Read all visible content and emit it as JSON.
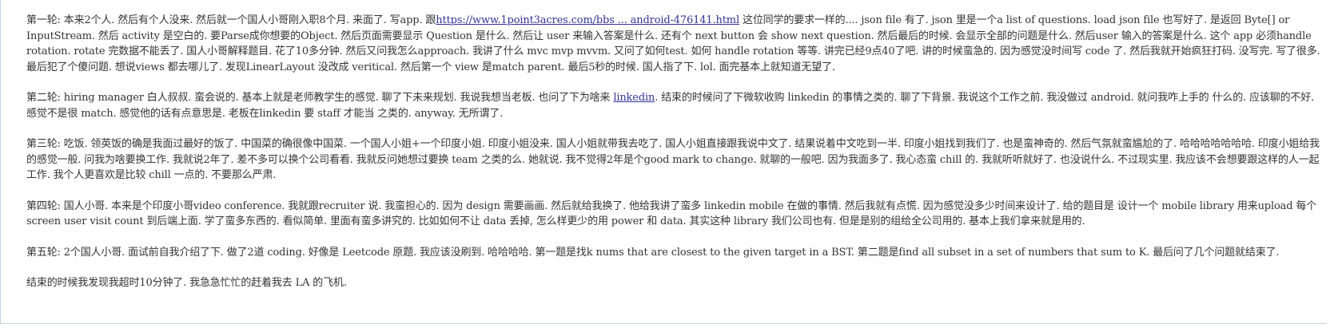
{
  "post": {
    "round1": {
      "before_link": "第一轮: 本来2个人. 然后有个人没来. 然后就一个国人小哥刚入职8个月. 来面了. 写app. 跟",
      "link_text": "https://www.1point3acres.com/bbs ... android-476141.html",
      "after_link": " 这位同学的要求一样的.... json file 有了. json 里是一个a list of questions. load json file 也写好了. 是返回 Byte[] or InputStream. 然后 activity 是空白的. 要Parse成你想要的Object. 然后页面需要显示 Question 是什么. 然后让 user 来输入答案是什么. 还有个 next button 会 show next question. 然后最后的时候. 会显示全部的问题是什么. 然后user 输入的答案是什么. 这个 app 必须handle rotation. rotate 完数据不能丢了. 国人小哥解释题目. 花了10多分钟. 然后又问我怎么approach. 我讲了什么 mvc mvp mvvm. 又问了如何test. 如何 handle rotation 等等. 讲完已经9点40了吧. 讲的时候蛮急的. 因为感觉没时间写 code 了. 然后我就开始疯狂打码. 没写完. 写了很多. 最后犯了个傻问题. 想说views 都去哪儿了. 发现LinearLayout 没改成 veritical. 然后第一个 view 是match parent. 最后5秒的时候. 国人指了下. lol. 面完基本上就知道无望了."
    },
    "round2": {
      "before_link": "第二轮: hiring manager 白人叔叔. 蛮会说的. 基本上就是老师教学生的感觉. 聊了下未来规划. 我说我想当老板. 也问了下为啥来 ",
      "link_text": "linkedin",
      "after_link": ". 结束的时候问了下微软收购 linkedin 的事情之类的. 聊了下背景. 我说这个工作之前. 我没做过 android. 就问我咋上手的 什么的. 应该聊的不好. 感觉不是很 match. 感觉他的话有点意思是. 老板在linkedin 要 staff 才能当 之类的. anyway. 无所谓了."
    },
    "round3": "第三轮: 吃饭. 领英饭的确是我面过最好的饭了. 中国菜的确很像中国菜. 一个国人小姐+一个印度小姐. 印度小姐没来. 国人小姐就带我去吃了. 国人小姐直接跟我说中文了. 结果说着中文吃到一半. 印度小姐找到我们了. 也是蛮神奇的. 然后气氛就蛮尴尬的了. 哈哈哈哈哈哈哈. 印度小姐给我的感觉一般. 问我为啥要换工作. 我就说2年了. 差不多可以换个公司看看. 我就反问她想过要换 team 之类的么. 她就说. 我不觉得2年是个good mark to change. 就聊的一般吧. 因为我面多了. 我心态蛮 chill 的. 我就听听就好了. 也没说什么. 不过现实里. 我应该不会想要跟这样的人一起工作. 我个人更喜欢是比较 chill 一点的. 不要那么严肃.",
    "round4": "第四轮: 国人小哥. 本来是个印度小哥video conference. 我就跟recruiter 说. 我蛮担心的. 因为 design 需要画画. 然后就给我换了. 他给我讲了蛮多 linkedin mobile 在做的事情. 然后我就有点慌. 因为感觉没多少时间来设计了. 给的题目是 设计一个 mobile library 用来upload 每个 screen user visit count 到后端上面. 学了蛮多东西的. 看似简单. 里面有蛮多讲究的. 比如如何不让 data 丢掉, 怎么样更少的用 power 和 data. 其实这种 library 我们公司也有. 但是是别的组给全公司用的. 基本上我们拿来就是用的.",
    "round5": "第五轮: 2个国人小哥. 面试前自我介绍了下. 做了2道 coding. 好像是 Leetcode 原题. 我应该没刷到. 哈哈哈哈. 第一题是找k nums that are closest to the given target in a BST. 第二题是find all subset in a set of numbers that sum to K. 最后问了几个问题就结束了.",
    "ending": "结束的时候我发现我超时10分钟了. 我急急忙忙的赶着我去 LA 的飞机."
  }
}
